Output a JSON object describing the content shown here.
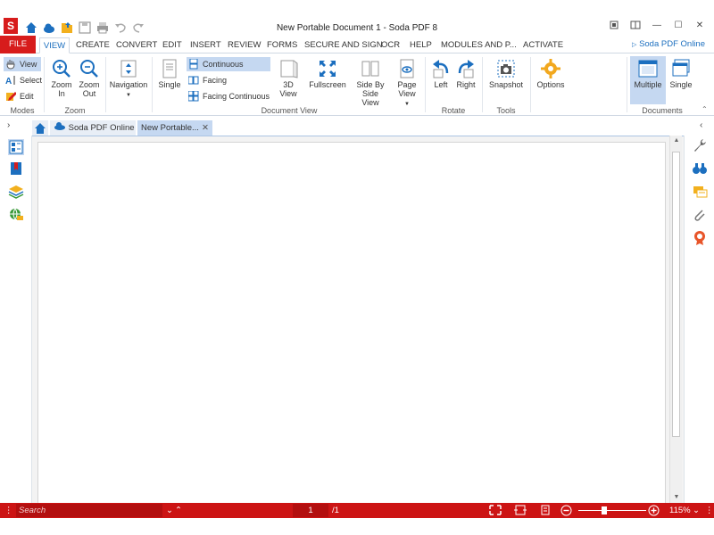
{
  "window": {
    "title": "New Portable Document 1   -   Soda PDF 8",
    "app_logo": "S",
    "controls": [
      "restore-icon",
      "layout-icon",
      "minimize",
      "maximize",
      "close"
    ]
  },
  "menu": {
    "tabs": [
      "FILE",
      "VIEW",
      "CREATE",
      "CONVERT",
      "EDIT",
      "INSERT",
      "REVIEW",
      "FORMS",
      "SECURE AND SIGN",
      "OCR",
      "HELP",
      "MODULES AND P...",
      "ACTIVATE"
    ],
    "active_tab": "VIEW",
    "online_link": "Soda PDF Online"
  },
  "ribbon": {
    "modes": {
      "view": "View",
      "select": "Select",
      "edit": "Edit",
      "group": "Modes"
    },
    "zoom": {
      "zoom_in": [
        "Zoom",
        "In"
      ],
      "zoom_out": [
        "Zoom",
        "Out"
      ],
      "group": "Zoom"
    },
    "navigation": {
      "label": "Navigation"
    },
    "document_view": {
      "single": "Single",
      "continuous": "Continuous",
      "facing": "Facing",
      "facing_continuous": "Facing Continuous",
      "view_3d": [
        "3D",
        "View"
      ],
      "fullscreen": "Fullscreen",
      "side_by_side": [
        "Side By",
        "Side",
        "View"
      ],
      "page_view": [
        "Page",
        "View"
      ],
      "group": "Document View"
    },
    "rotate": {
      "left": "Left",
      "right": "Right",
      "group": "Rotate"
    },
    "tools": {
      "snapshot": "Snapshot",
      "group": "Tools"
    },
    "options": {
      "label": "Options"
    },
    "documents": {
      "multiple": "Multiple",
      "single": "Single",
      "group": "Documents"
    }
  },
  "doc_tabs": [
    {
      "label": "Soda PDF Online"
    },
    {
      "label": "New Portable..."
    }
  ],
  "statusbar": {
    "search_placeholder": "Search",
    "page_current": "1",
    "page_total": "/1",
    "zoom": "115%"
  },
  "colors": {
    "brand_red": "#cc1414",
    "accent_blue": "#1c6fbf",
    "selected_bg": "#c5d8f1"
  }
}
